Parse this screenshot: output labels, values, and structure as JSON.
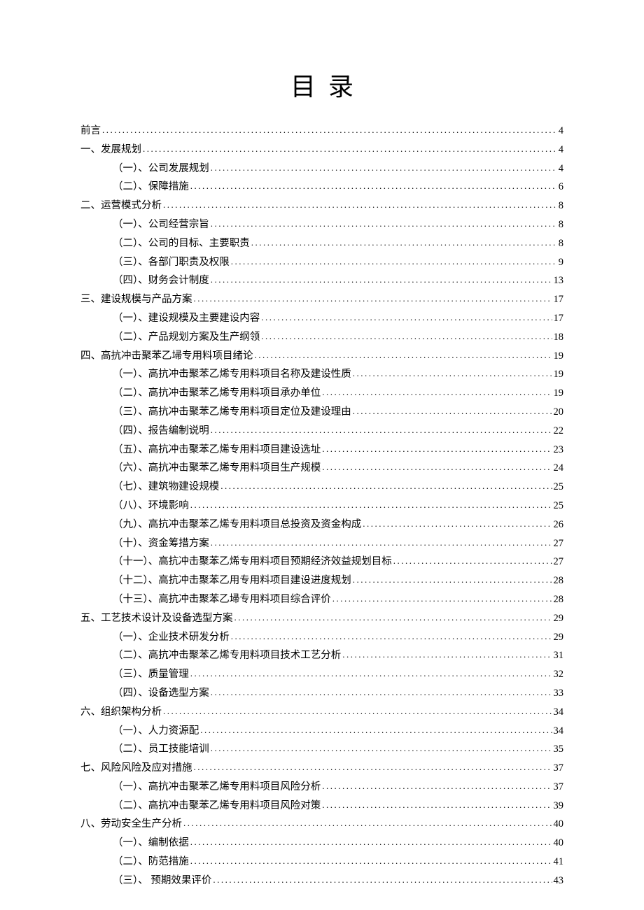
{
  "title": "目录",
  "entries": [
    {
      "level": 0,
      "label": "前言",
      "page": "4"
    },
    {
      "level": 0,
      "label": "一、发展规划",
      "page": "4"
    },
    {
      "level": 1,
      "label": "（一）、公司发展规划",
      "page": "4"
    },
    {
      "level": 1,
      "label": "（二）、保障措施",
      "page": "6"
    },
    {
      "level": 0,
      "label": "二、运营模式分析",
      "page": "8"
    },
    {
      "level": 1,
      "label": "（一）、公司经营宗旨",
      "page": "8"
    },
    {
      "level": 1,
      "label": "（二）、公司的目标、主要职责",
      "page": "8"
    },
    {
      "level": 1,
      "label": "（三）、各部门职责及权限",
      "page": "9"
    },
    {
      "level": 1,
      "label": "（四）、财务会计制度",
      "page": "13"
    },
    {
      "level": 0,
      "label": "三、建设规模与产品方案",
      "page": "17"
    },
    {
      "level": 1,
      "label": "（一）、建设规模及主要建设内容",
      "page": "17"
    },
    {
      "level": 1,
      "label": "（二）、产品规划方案及生产纲领",
      "page": "18"
    },
    {
      "level": 0,
      "label": "四、高抗冲击聚苯乙埽专用料项目绪论",
      "page": "19"
    },
    {
      "level": 1,
      "label": "（一）、高抗冲击聚苯乙烯专用料项目名称及建设性质",
      "page": "19"
    },
    {
      "level": 1,
      "label": "（二）、高抗冲击聚苯乙烯专用料项目承办单位",
      "page": "19"
    },
    {
      "level": 1,
      "label": "（三）、高抗冲击聚苯乙烯专用料项目定位及建设理由",
      "page": "20"
    },
    {
      "level": 1,
      "label": "（四）、报告编制说明",
      "page": "22"
    },
    {
      "level": 1,
      "label": "（五）、高抗冲击聚苯乙烯专用料项目建设选址",
      "page": "23"
    },
    {
      "level": 1,
      "label": "（六）、高抗冲击聚苯乙烯专用料项目生产规模",
      "page": "24"
    },
    {
      "level": 1,
      "label": "（七）、建筑物建设规模",
      "page": "25"
    },
    {
      "level": 1,
      "label": "（八）、环境影响",
      "page": "25"
    },
    {
      "level": 1,
      "label": "（九）、高抗冲击聚苯乙烯专用料项目总投资及资金构成",
      "page": "26"
    },
    {
      "level": 1,
      "label": "（十）、资金筹措方案",
      "page": "27"
    },
    {
      "level": 1,
      "label": "（十一）、高抗冲击聚苯乙烯专用料项目预期经济效益规划目标",
      "page": "27"
    },
    {
      "level": 1,
      "label": "（十二）、高抗冲击聚苯乙用专用料项目建设进度规划",
      "page": "28"
    },
    {
      "level": 1,
      "label": "（十三）、高抗冲击聚苯乙埽专用料项目综合评价",
      "page": "28"
    },
    {
      "level": 0,
      "label": "五、工艺技术设计及设备选型方案",
      "page": "29"
    },
    {
      "level": 1,
      "label": "（一）、企业技术研发分析",
      "page": "29"
    },
    {
      "level": 1,
      "label": "（二）、高抗冲击聚苯乙烯专用料项目技术工艺分析",
      "page": "31"
    },
    {
      "level": 1,
      "label": "（三）、质量管理",
      "page": "32"
    },
    {
      "level": 1,
      "label": "（四）、设备选型方案",
      "page": "33"
    },
    {
      "level": 0,
      "label": "六、组织架构分析",
      "page": "34"
    },
    {
      "level": 1,
      "label": "（一）、人力资源配",
      "page": "34"
    },
    {
      "level": 1,
      "label": "（二）、员工技能培训",
      "page": "35"
    },
    {
      "level": 0,
      "label": "七、风险风险及应对措施",
      "page": "37"
    },
    {
      "level": 1,
      "label": "（一）、高抗冲击聚苯乙烯专用料项目风险分析",
      "page": "37"
    },
    {
      "level": 1,
      "label": "（二）、高抗冲击聚苯乙烯专用料项目风险对策",
      "page": "39"
    },
    {
      "level": 0,
      "label": "八、劳动安全生产分析",
      "page": "40"
    },
    {
      "level": 1,
      "label": "（一）、编制依据",
      "page": "40"
    },
    {
      "level": 1,
      "label": "（二）、防范措施",
      "page": "41"
    },
    {
      "level": 1,
      "label": "（三）、 预期效果评价",
      "page": "43"
    }
  ]
}
